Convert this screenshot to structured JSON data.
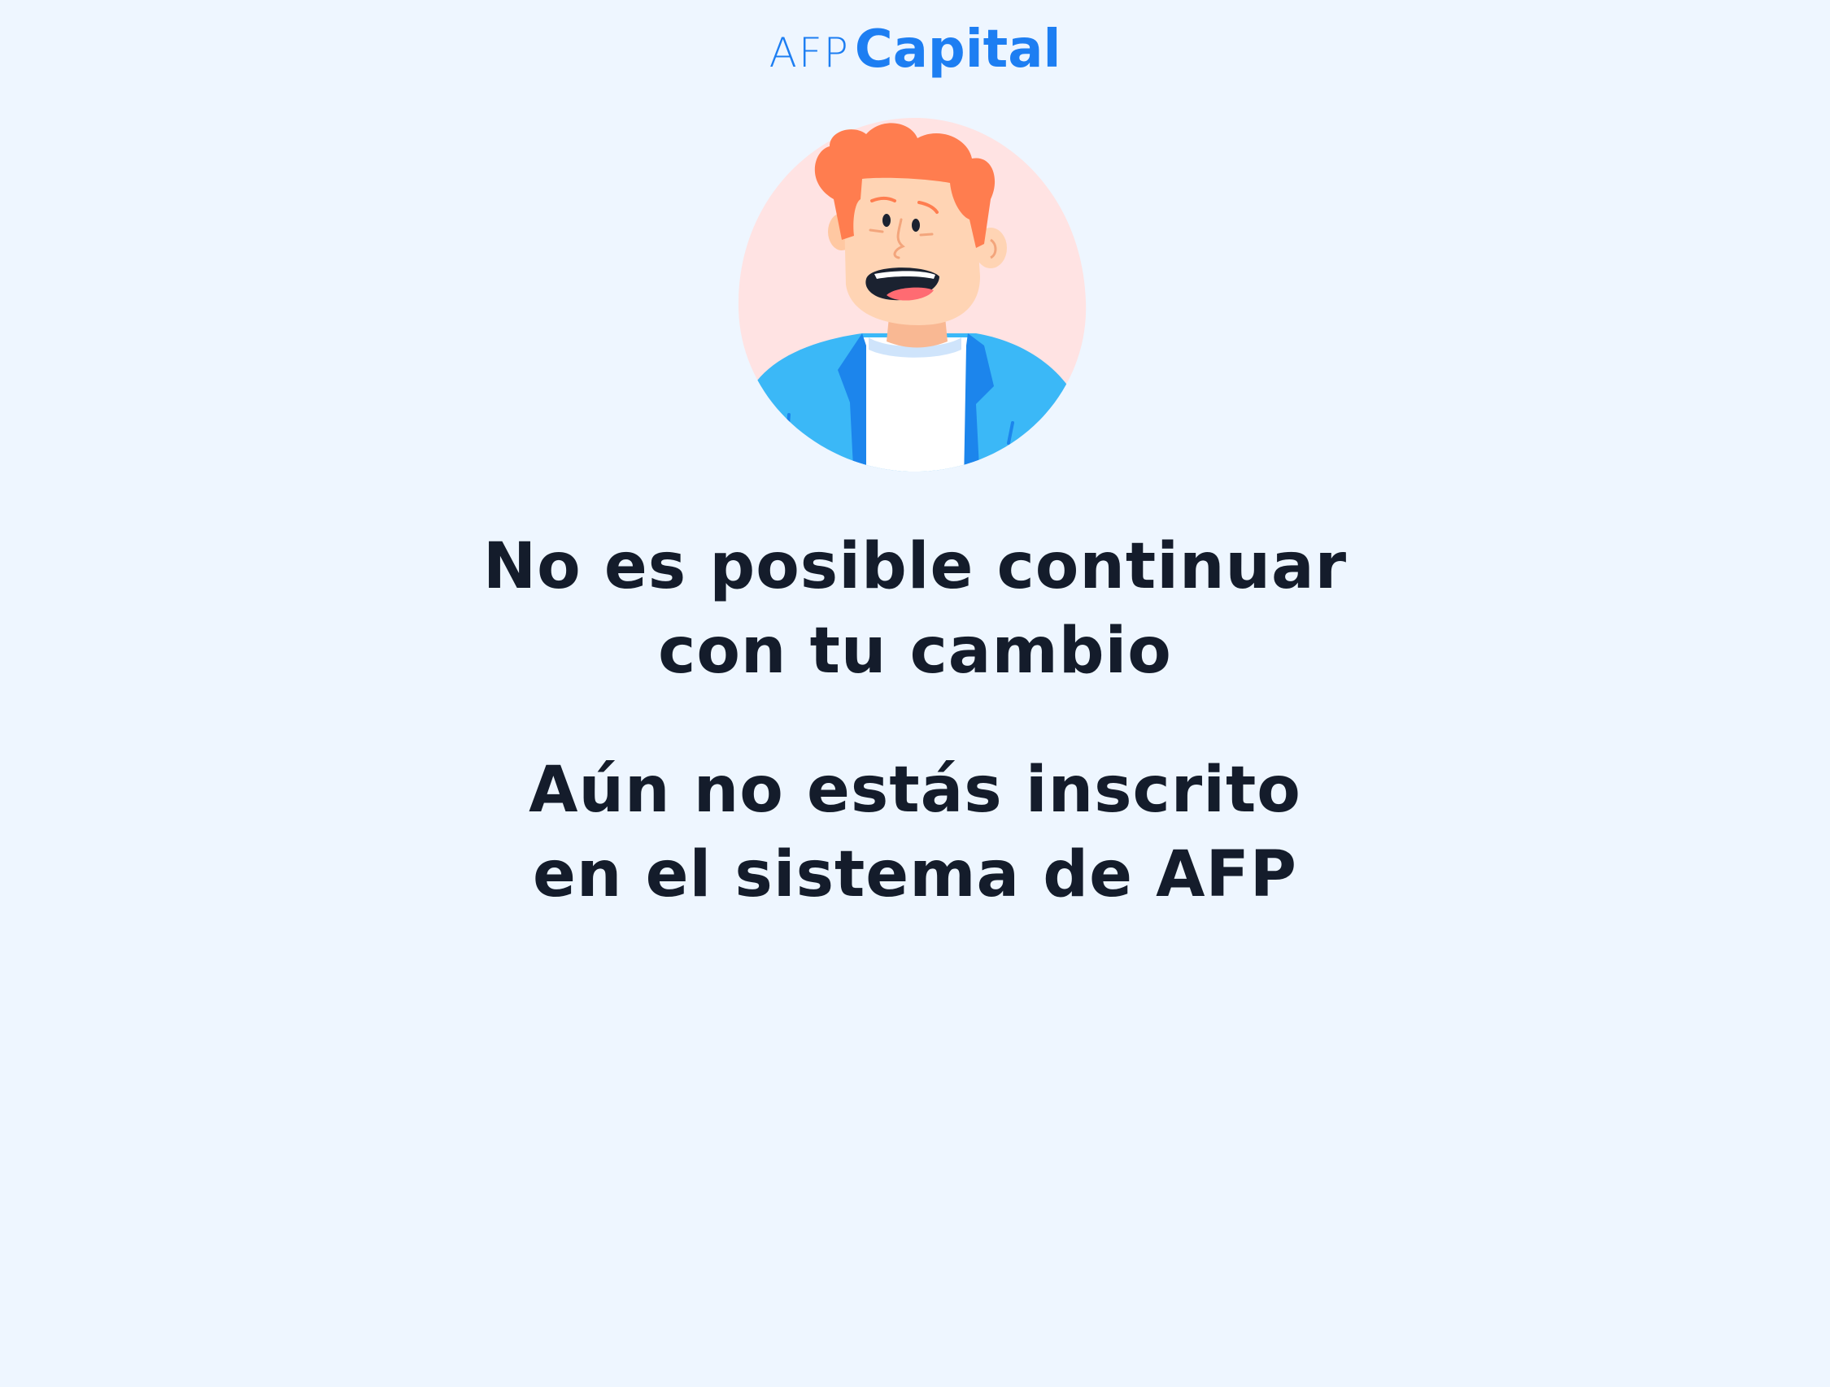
{
  "logo": {
    "prefix": "AFP",
    "name": "Capital"
  },
  "illustration": {
    "icon": "worried-person-icon",
    "colors": {
      "backdrop": "#ffe3e3",
      "hair": "#ff7d4f",
      "skin": "#ffd4b4",
      "jacket_light": "#3bb8f7",
      "jacket_dark": "#1c85ec",
      "shirt": "#ffffff",
      "mouth": "#1b2230",
      "tongue": "#ff6b72"
    }
  },
  "message": {
    "title_line1": "No es posible continuar",
    "title_line2": "con tu cambio",
    "subtitle_line1": "Aún no estás inscrito",
    "subtitle_line2": "en el sistema de AFP"
  },
  "colors": {
    "background": "#eef6ff",
    "brand": "#1d7ef2",
    "text": "#141c2b"
  }
}
